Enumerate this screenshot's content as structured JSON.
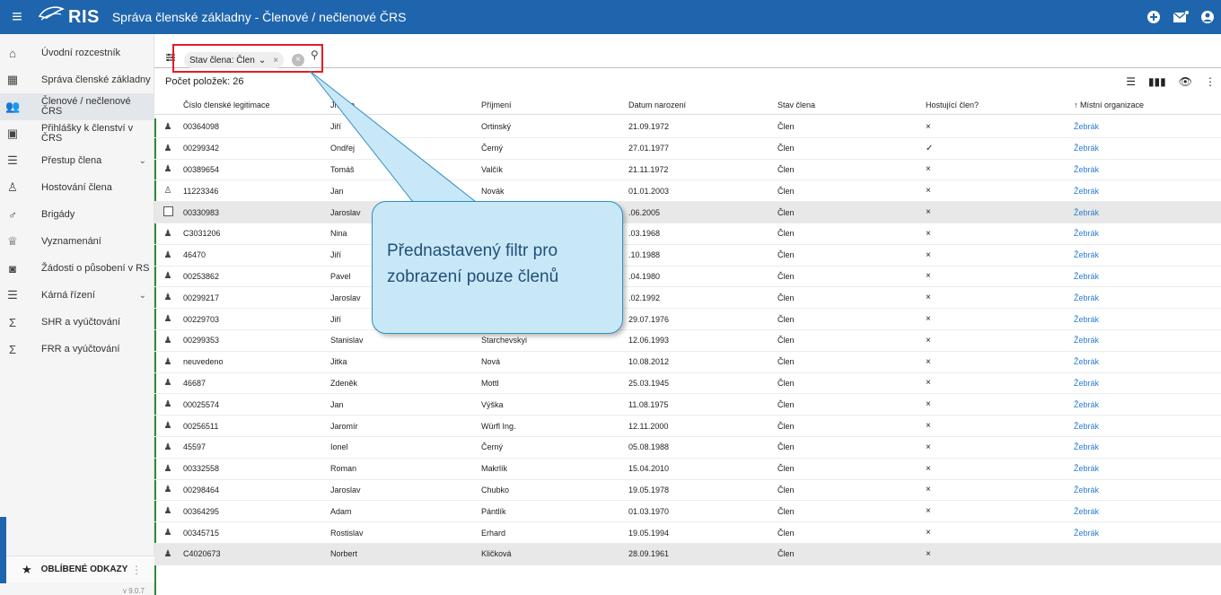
{
  "header": {
    "app_name": "RIS",
    "title": "Správa členské základny - Členové / nečlenové ČRS"
  },
  "sidebar": {
    "items": [
      {
        "label": "Úvodní rozcestník",
        "icon": "home-icon"
      },
      {
        "label": "Správa členské základny",
        "icon": "grid-icon"
      },
      {
        "label": "Členové / nečlenové ČRS",
        "icon": "people-icon"
      },
      {
        "label": "Přihlášky k členství v ČRS",
        "icon": "application-icon"
      },
      {
        "label": "Přestup člena",
        "icon": "list-icon"
      },
      {
        "label": "Hostování člena",
        "icon": "guest-icon"
      },
      {
        "label": "Brigády",
        "icon": "brigade-icon"
      },
      {
        "label": "Vyznamenání",
        "icon": "trophy-icon"
      },
      {
        "label": "Žádosti o působení v RS",
        "icon": "request-icon"
      },
      {
        "label": "Kárná řízení",
        "icon": "list-icon"
      },
      {
        "label": "SHR a vyúčtování",
        "icon": "sum-icon"
      },
      {
        "label": "FRR a vyúčtování",
        "icon": "sum-icon"
      }
    ],
    "favorites_label": "OBLÍBENÉ ODKAZY",
    "version": "v 9.0.7"
  },
  "filter": {
    "chip_label": "Stav člena: Člen"
  },
  "count_label": "Počet položek: 26",
  "table": {
    "headers": [
      "Číslo členské legitimace",
      "Jméno",
      "Příjmení",
      "Datum narození",
      "Stav člena",
      "Hostující člen?",
      "↑ Místní organizace"
    ],
    "rows": [
      [
        "00364098",
        "Jiří",
        "Ortinský",
        "21.09.1972",
        "Člen",
        "×",
        "Žebrák"
      ],
      [
        "00299342",
        "Ondřej",
        "Černý",
        "27.01.1977",
        "Člen",
        "✓",
        "Žebrák"
      ],
      [
        "00389654",
        "Tomáš",
        "Valčík",
        "21.11.1972",
        "Člen",
        "×",
        "Žebrák"
      ],
      [
        "11223346",
        "Jan",
        "Novák",
        "01.01.2003",
        "Člen",
        "×",
        "Žebrák"
      ],
      [
        "00330983",
        "Jaroslav",
        "",
        ".06.2005",
        "Člen",
        "×",
        "Žebrák"
      ],
      [
        "C3031206",
        "Nina",
        "",
        ".03.1968",
        "Člen",
        "×",
        "Žebrák"
      ],
      [
        "46470",
        "Jiří",
        "",
        ".10.1988",
        "Člen",
        "×",
        "Žebrák"
      ],
      [
        "00253862",
        "Pavel",
        "",
        ".04.1980",
        "Člen",
        "×",
        "Žebrák"
      ],
      [
        "00299217",
        "Jaroslav",
        "",
        ".02.1992",
        "Člen",
        "×",
        "Žebrák"
      ],
      [
        "00229703",
        "Jiří",
        "Kunc",
        "29.07.1976",
        "Člen",
        "×",
        "Žebrák"
      ],
      [
        "00299353",
        "Stanislav",
        "Starchevskyi",
        "12.06.1993",
        "Člen",
        "×",
        "Žebrák"
      ],
      [
        "neuvedeno",
        "Jitka",
        "Nová",
        "10.08.2012",
        "Člen",
        "×",
        "Žebrák"
      ],
      [
        "46687",
        "Zdeněk",
        "Mottl",
        "25.03.1945",
        "Člen",
        "×",
        "Žebrák"
      ],
      [
        "00025574",
        "Jan",
        "Výška",
        "11.08.1975",
        "Člen",
        "×",
        "Žebrák"
      ],
      [
        "00256511",
        "Jaromír",
        "Würfl Ing.",
        "12.11.2000",
        "Člen",
        "×",
        "Žebrák"
      ],
      [
        "45597",
        "Ionel",
        "Černý",
        "05.08.1988",
        "Člen",
        "×",
        "Žebrák"
      ],
      [
        "00332558",
        "Roman",
        "Makrlík",
        "15.04.2010",
        "Člen",
        "×",
        "Žebrák"
      ],
      [
        "00298464",
        "Jaroslav",
        "Chubko",
        "19.05.1978",
        "Člen",
        "×",
        "Žebrák"
      ],
      [
        "00364295",
        "Adam",
        "Pántlík",
        "01.03.1970",
        "Člen",
        "×",
        "Žebrák"
      ],
      [
        "00345715",
        "Rostislav",
        "Erhard",
        "19.05.1994",
        "Člen",
        "×",
        "Žebrák"
      ],
      [
        "C4020673",
        "Norbert",
        "Kličková",
        "28.09.1961",
        "Člen",
        "×",
        ""
      ]
    ]
  },
  "callout": {
    "text": "Přednastavený filtr pro zobrazení pouze členů"
  },
  "colors": {
    "topbar": "#1f65ad",
    "highlight_border": "#e21d24",
    "callout_fill": "#c9e8f7",
    "link": "#2b7bd1"
  }
}
